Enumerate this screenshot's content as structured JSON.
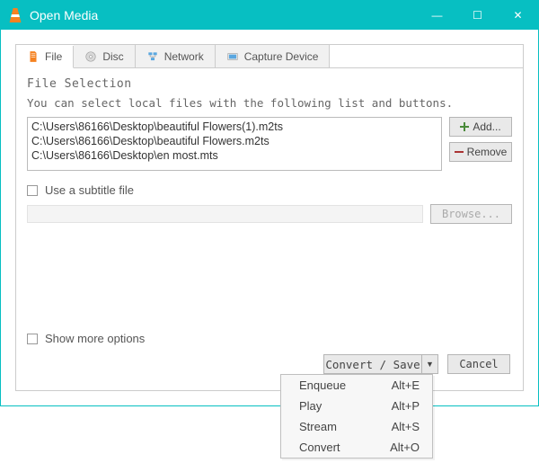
{
  "window": {
    "title": "Open Media"
  },
  "win_btns": {
    "min": "—",
    "max": "☐",
    "close": "✕"
  },
  "tabs": [
    {
      "id": "file",
      "label": "File"
    },
    {
      "id": "disc",
      "label": "Disc"
    },
    {
      "id": "network",
      "label": "Network"
    },
    {
      "id": "capture",
      "label": "Capture Device"
    }
  ],
  "file_selection": {
    "title": "File Selection",
    "hint": "You can select local files with the following list and buttons.",
    "files": [
      "C:\\Users\\86166\\Desktop\\beautiful Flowers(1).m2ts",
      "C:\\Users\\86166\\Desktop\\beautiful Flowers.m2ts",
      "C:\\Users\\86166\\Desktop\\en most.mts"
    ],
    "add": "Add...",
    "remove": "Remove"
  },
  "subtitle": {
    "checkbox_label": "Use a subtitle file",
    "browse": "Browse..."
  },
  "show_more": {
    "label": "Show more options"
  },
  "actions": {
    "convert_save": "Convert / Save",
    "cancel": "Cancel"
  },
  "dropdown": [
    {
      "label": "Enqueue",
      "shortcut": "Alt+E"
    },
    {
      "label": "Play",
      "shortcut": "Alt+P"
    },
    {
      "label": "Stream",
      "shortcut": "Alt+S"
    },
    {
      "label": "Convert",
      "shortcut": "Alt+O"
    }
  ]
}
